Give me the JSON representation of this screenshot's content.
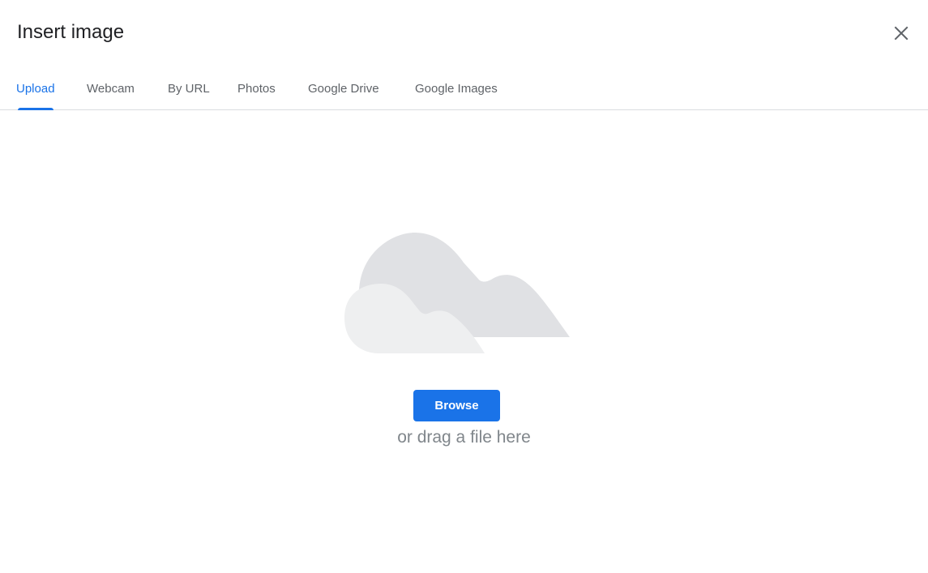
{
  "dialog": {
    "title": "Insert image",
    "close_icon": "close-icon"
  },
  "tabs": [
    {
      "label": "Upload",
      "active": true
    },
    {
      "label": "Webcam",
      "active": false
    },
    {
      "label": "By URL",
      "active": false
    },
    {
      "label": "Photos",
      "active": false
    },
    {
      "label": "Google Drive",
      "active": false
    },
    {
      "label": "Google Images",
      "active": false
    }
  ],
  "upload": {
    "illustration_icon": "cloud-upload-illustration",
    "browse_label": "Browse",
    "drag_text": "or drag a file here"
  },
  "colors": {
    "accent": "#1a73e8",
    "title_text": "#202124",
    "tab_text": "#5f6368",
    "muted_text": "#80868b",
    "divider": "#dadce0",
    "cloud_back": "#e0e1e4",
    "cloud_front": "#eeeff0"
  }
}
